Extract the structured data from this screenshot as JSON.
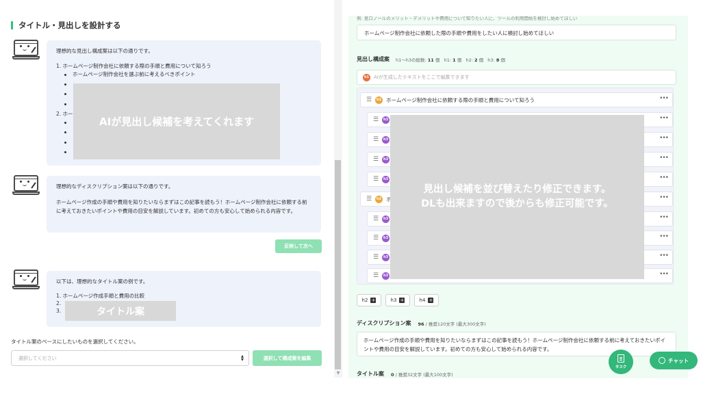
{
  "left": {
    "section_title": "タイトル・見出しを設計する",
    "bubble1": {
      "lead": "理想的な見出し構成案は以下の通りです。",
      "item1": "1. ホームページ制作会社に依頼する際の手順と費用について知ろう",
      "sub1": "ホームページ制作会社を選ぶ前に考えるべきポイント",
      "item2": "2. ホー"
    },
    "overlay1": "AIが見出し候補を考えてくれます",
    "bubble2": {
      "lead": "理想的なディスクリプション案は以下の通りです。",
      "body": "ホームページ作成の手順や費用を知りたいならまずはこの記事を読もう！ホームページ制作会社に依頼する前に考えておきたいポイントや費用の目安を解説しています。初めての方も安心して始められる内容です。"
    },
    "reflect_button": "反映して次へ",
    "bubble3": {
      "lead": "以下は、理想的なタイトル案の例です。",
      "item1": "1. ホームページ作成手順と費用の比較",
      "item2": "2.",
      "item3": "3."
    },
    "overlay3": "タイトル案",
    "select_label": "タイトル案のベースにしたいものを選択してください。",
    "select_placeholder": "選択してください",
    "compose_button": "選択して構成案を編集"
  },
  "right": {
    "cut_text": "例: 見ロノールのメリット・デメリットや費用について知りたい人に、ツールの利用開始を検討し始めてほしい",
    "target_input": "ホームページ制作会社に依頼した際の手順や費用をしたい人に検討し始めてほしい",
    "outline_title": "見出し構成案",
    "outline_meta": {
      "total_label": "h1〜h3の総数:",
      "total": "11",
      "unit": "個",
      "h1_label": "h1:",
      "h1": "1",
      "h2_label": "h2:",
      "h2": "2",
      "h3_label": "h3:",
      "h3": "8"
    },
    "h1_placeholder": "AIが生成したテキストをここで編集できます",
    "h2_first": "ホームページ制作会社に依頼する際の手順と費用について知ろう",
    "h2_second_fragment": "ホ",
    "badges": {
      "h1": "h1",
      "h2": "h2",
      "h3": "h3"
    },
    "overlay": "見出し候補を並び替えたり修正できます。\nDLも出来ますので後からも修正可能です。",
    "add_buttons": [
      "h2",
      "h3",
      "h4"
    ],
    "description_title": "ディスクリプション案",
    "description_count": "96",
    "description_limit": "/ 推奨120文字 (最大300文字)",
    "description_text": "ホームページ作成の手順や費用を知りたいならまずはこの記事を読もう！ホームページ制作会社に依頼する前に考えておきたいポイントや費用の目安を解説しています。初めての方も安心して始められる内容です。",
    "title_label": "タイトル案",
    "title_count": "0",
    "title_limit": "/ 推奨32文字 (最大100文字)"
  },
  "floating": {
    "task_label": "タスク",
    "chat_label": "チャット"
  }
}
